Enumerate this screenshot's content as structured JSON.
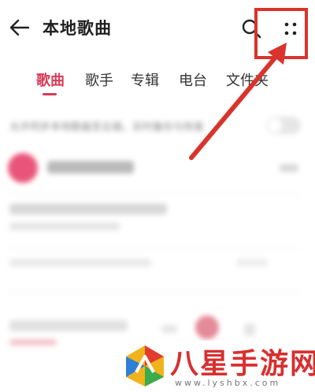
{
  "header": {
    "title": "本地歌曲",
    "back_icon": "arrow-left-icon",
    "search_icon": "search-icon",
    "more_icon": "more-dots-icon"
  },
  "tabs": [
    {
      "label": "歌曲",
      "active": true
    },
    {
      "label": "歌手",
      "active": false
    },
    {
      "label": "专辑",
      "active": false
    },
    {
      "label": "电台",
      "active": false
    },
    {
      "label": "文件夹",
      "active": false
    }
  ],
  "content": {
    "sync_text": "允许同步本地歌曲至云端，实时备份与恢复",
    "sync_toggle_on": false
  },
  "annotation": {
    "color": "#d8342c"
  },
  "watermark": {
    "name": "八星手游网",
    "url": "www.lyshbx.com"
  },
  "colors": {
    "accent": "#d93b57",
    "annotation": "#d8342c",
    "watermark": "#d82f2f"
  }
}
